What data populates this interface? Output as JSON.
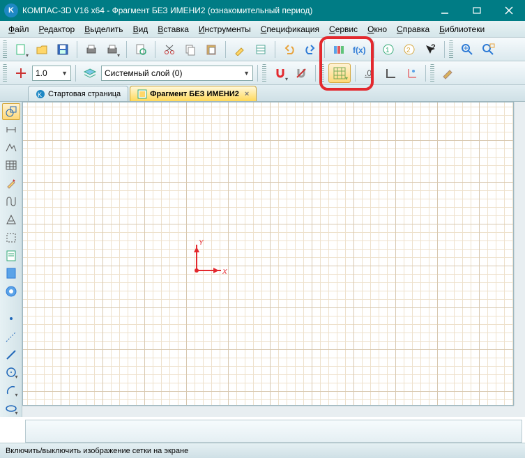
{
  "title_bar": {
    "app_icon_letter": "K",
    "title": "КОМПАС-3D V16  x64 - Фрагмент БЕЗ ИМЕНИ2 (ознакомительный период)"
  },
  "menu": {
    "items": [
      "Файл",
      "Редактор",
      "Выделить",
      "Вид",
      "Вставка",
      "Инструменты",
      "Спецификация",
      "Сервис",
      "Окно",
      "Справка",
      "Библиотеки"
    ]
  },
  "toolbar_row2": {
    "scale_value": "1.0",
    "layer_value": "Системный слой (0)"
  },
  "tabs": {
    "items": [
      {
        "label": "Стартовая страница",
        "active": false
      },
      {
        "label": "Фрагмент БЕЗ ИМЕНИ2",
        "active": true
      }
    ]
  },
  "axes": {
    "x": "X",
    "y": "Y"
  },
  "status": {
    "text": "Включить/выключить изображение сетки на экране"
  }
}
